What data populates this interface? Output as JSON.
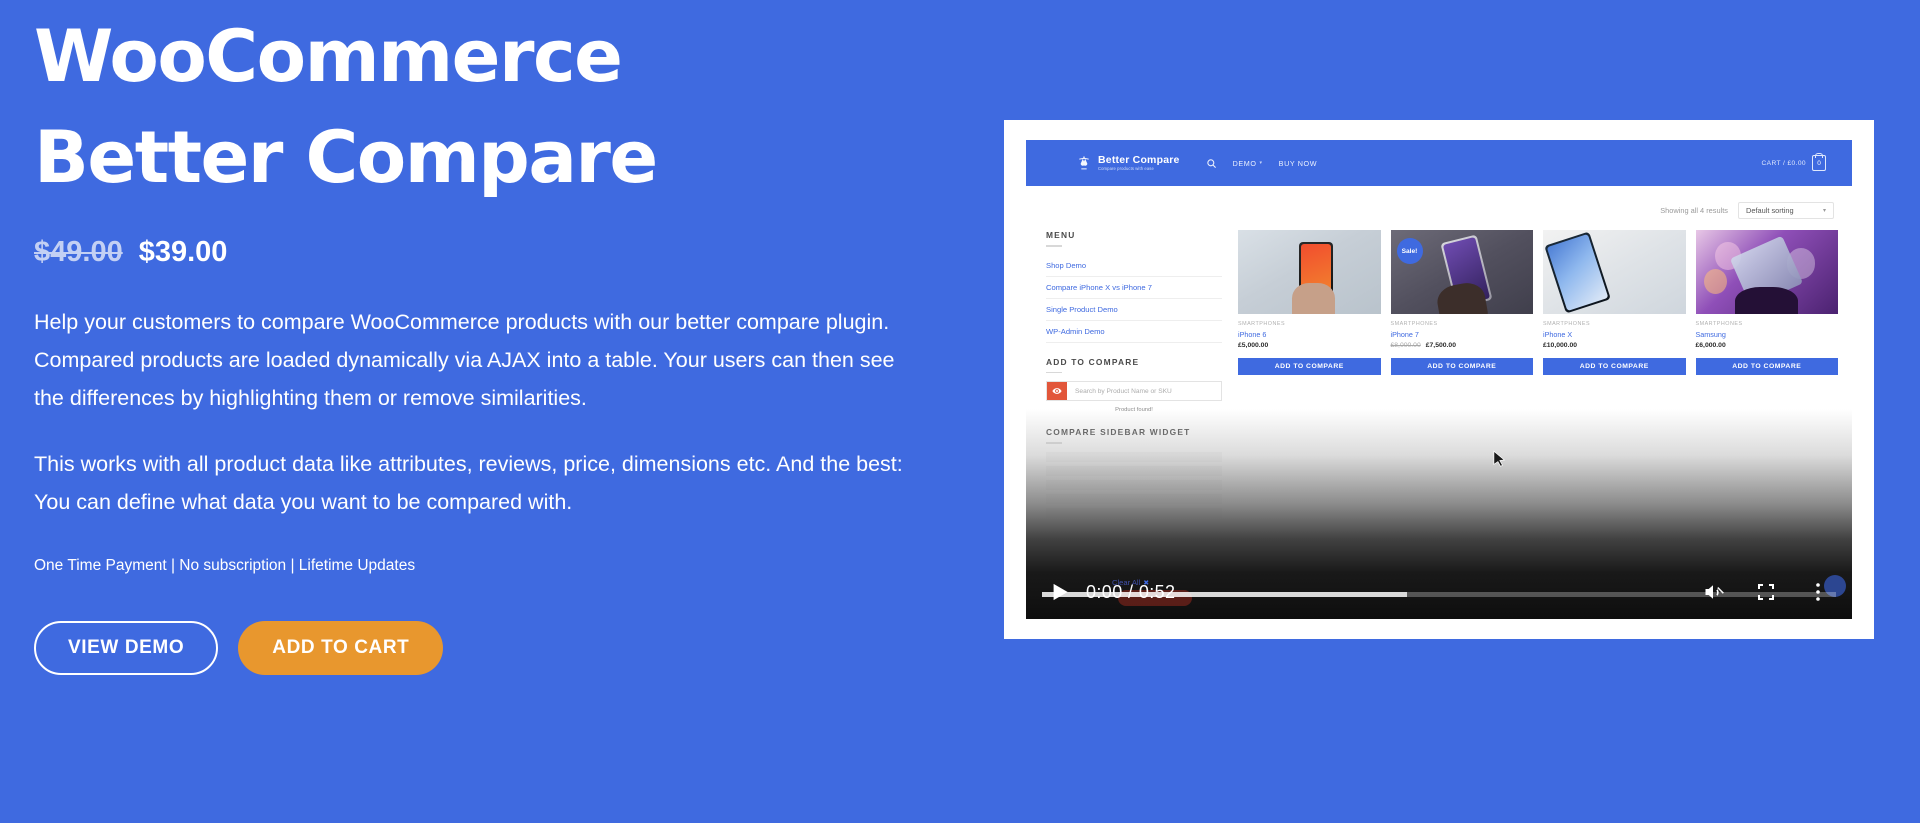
{
  "hero": {
    "title_line1": "WooCommerce",
    "title_line2": "Better Compare",
    "price_old": "$49.00",
    "price_new": "$39.00",
    "paragraph1": "Help your customers to compare WooCommerce products with our better compare plugin. Compared products are loaded dynamically via AJAX into a table. Your users can then see the differences by highlighting them or remove similarities.",
    "paragraph2": "This works with all product data like attributes, reviews, price, dimensions etc. And the best: You can define what data you want to be compared with.",
    "fineprint": "One Time Payment | No subscription | Lifetime Updates",
    "btn_demo": "VIEW DEMO",
    "btn_cart": "ADD TO CART",
    "background_color": "#3f6ae0",
    "accent_color": "#e8972e"
  },
  "video": {
    "current_time": "0:00",
    "duration": "0:52",
    "time_label": "0:00 / 0:52",
    "play_icon": "play-icon",
    "mute_icon": "muted-volume-icon",
    "fullscreen_icon": "fullscreen-icon",
    "more_icon": "more-options-icon",
    "progress_played_percent": 0,
    "progress_loaded_percent": 46
  },
  "demo_site": {
    "header": {
      "logo_title": "Better Compare",
      "logo_subtitle": "Compare products with ease",
      "nav": [
        {
          "label": "DEMO",
          "has_caret": true
        },
        {
          "label": "BUY NOW",
          "has_caret": false
        }
      ],
      "cart_label": "CART / £0.00",
      "cart_count": "0"
    },
    "toolbar": {
      "results_text": "Showing all 4 results",
      "sorting_value": "Default sorting"
    },
    "sidebar": {
      "menu_heading": "MENU",
      "menu_links": [
        "Shop Demo",
        "Compare iPhone X vs iPhone 7",
        "Single Product Demo",
        "WP-Admin Demo"
      ],
      "compare_heading": "ADD TO COMPARE",
      "search_placeholder": "Search by Product Name or SKU",
      "found_text": "Product found!",
      "widget_heading": "COMPARE SIDEBAR WIDGET",
      "clear_all": "Clear All",
      "clear_all_x": "✖"
    },
    "products": [
      {
        "category": "SMARTPHONES",
        "name": "iPhone 6",
        "price": "£5,000.00",
        "price_was": "",
        "on_sale": false,
        "sale_label": "",
        "button": "ADD TO COMPARE"
      },
      {
        "category": "SMARTPHONES",
        "name": "iPhone 7",
        "price": "£7,500.00",
        "price_was": "£8,000.00",
        "on_sale": true,
        "sale_label": "Sale!",
        "button": "ADD TO COMPARE"
      },
      {
        "category": "SMARTPHONES",
        "name": "iPhone X",
        "price": "£10,000.00",
        "price_was": "",
        "on_sale": false,
        "sale_label": "",
        "button": "ADD TO COMPARE"
      },
      {
        "category": "SMARTPHONES",
        "name": "Samsung",
        "price": "£6,000.00",
        "price_was": "",
        "on_sale": false,
        "sale_label": "",
        "button": "ADD TO COMPARE"
      }
    ]
  }
}
